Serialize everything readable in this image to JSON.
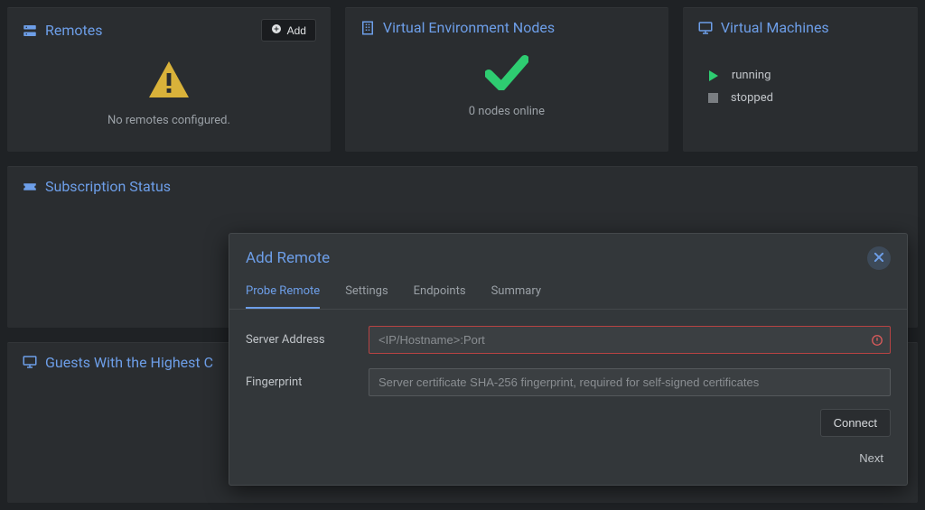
{
  "cards": {
    "remotes": {
      "title": "Remotes",
      "add_label": "Add",
      "empty_text": "No remotes configured."
    },
    "nodes": {
      "title": "Virtual Environment Nodes",
      "status_text": "0 nodes online"
    },
    "vms": {
      "title": "Virtual Machines",
      "running_label": "running",
      "stopped_label": "stopped"
    },
    "subscription": {
      "title": "Subscription Status"
    },
    "guests": {
      "title": "Guests With the Highest C"
    }
  },
  "modal": {
    "title": "Add Remote",
    "tabs": {
      "probe": "Probe Remote",
      "settings": "Settings",
      "endpoints": "Endpoints",
      "summary": "Summary"
    },
    "form": {
      "server_label": "Server Address",
      "server_placeholder": "<IP/Hostname>:Port",
      "server_value": "",
      "fingerprint_label": "Fingerprint",
      "fingerprint_placeholder": "Server certificate SHA-256 fingerprint, required for self-signed certificates",
      "fingerprint_value": ""
    },
    "connect_label": "Connect",
    "next_label": "Next"
  }
}
